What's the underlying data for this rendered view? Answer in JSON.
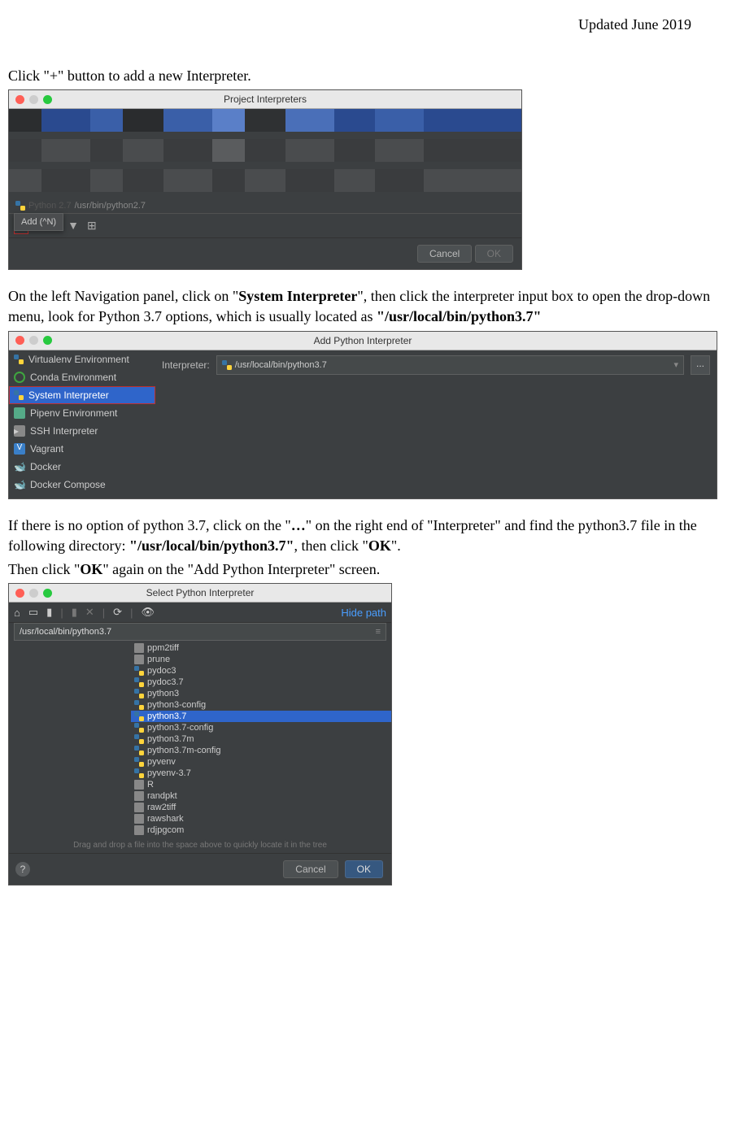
{
  "header_date": "Updated June 2019",
  "para1": "Click \"+\" button to add a new Interpreter.",
  "para2_a": "On the left Navigation panel, click on \"",
  "para2_b": "System Interpreter",
  "para2_c": "\", then click the interpreter input box to open the drop-down menu, look for Python 3.7 options, which is usually located as ",
  "para2_d": "\"/usr/local/bin/python3.7\"",
  "para3_a": "If there is no option of python 3.7, click on the \"",
  "para3_b": "…",
  "para3_c": "\" on the right end of \"Interpreter\" and find the python3.7 file in the following directory: ",
  "para3_d": "\"/usr/local/bin/python3.7\"",
  "para3_e": ", then click \"",
  "para3_f": "OK",
  "para3_g": "\".",
  "para4_a": "Then click \"",
  "para4_b": "OK",
  "para4_c": "\" again on the \"Add Python Interpreter\" screen.",
  "dialog1": {
    "title": "Project Interpreters",
    "python_row": "/usr/bin/python2.7",
    "tooltip": "Add (^N)",
    "cancel": "Cancel",
    "ok": "OK"
  },
  "dialog2": {
    "title": "Add Python Interpreter",
    "nav": [
      "Virtualenv Environment",
      "Conda Environment",
      "System Interpreter",
      "Pipenv Environment",
      "SSH Interpreter",
      "Vagrant",
      "Docker",
      "Docker Compose"
    ],
    "label": "Interpreter:",
    "value": "/usr/local/bin/python3.7",
    "dots": "..."
  },
  "dialog3": {
    "title": "Select Python Interpreter",
    "hide_path": "Hide path",
    "path": "/usr/local/bin/python3.7",
    "files": [
      "ppm2tiff",
      "prune",
      "pydoc3",
      "pydoc3.7",
      "python3",
      "python3-config",
      "python3.7",
      "python3.7-config",
      "python3.7m",
      "python3.7m-config",
      "pyvenv",
      "pyvenv-3.7",
      "R",
      "randpkt",
      "raw2tiff",
      "rawshark",
      "rdjpgcom"
    ],
    "selected_index": 6,
    "hint": "Drag and drop a file into the space above to quickly locate it in the tree",
    "cancel": "Cancel",
    "ok": "OK"
  }
}
